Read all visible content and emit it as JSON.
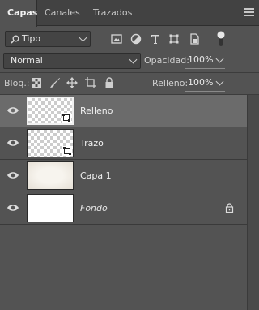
{
  "tabs": [
    {
      "label": "Capas",
      "active": true
    },
    {
      "label": "Canales",
      "active": false
    },
    {
      "label": "Trazados",
      "active": false
    }
  ],
  "filter": {
    "kind_label": "Tipo",
    "icons": [
      "image-filter-icon",
      "adjustment-filter-icon",
      "type-filter-icon",
      "shape-filter-icon",
      "smart-object-filter-icon",
      "filter-toggle-icon"
    ]
  },
  "blend": {
    "mode": "Normal",
    "opacity_label": "Opacidad:",
    "opacity_value": "100%"
  },
  "lock": {
    "label": "Bloq.:",
    "icons": [
      "lock-transparency-icon",
      "lock-pixels-icon",
      "lock-position-icon",
      "lock-artboard-icon",
      "lock-all-icon"
    ],
    "fill_label": "Relleno:",
    "fill_value": "100%"
  },
  "layers": [
    {
      "name": "Relleno",
      "thumb": "checker",
      "smart": true,
      "selected": true,
      "italic": false,
      "locked": false
    },
    {
      "name": "Trazo",
      "thumb": "checker",
      "smart": true,
      "selected": false,
      "italic": false,
      "locked": false
    },
    {
      "name": "Capa 1",
      "thumb": "paper",
      "smart": false,
      "selected": false,
      "italic": false,
      "locked": false
    },
    {
      "name": "Fondo",
      "thumb": "white",
      "smart": false,
      "selected": false,
      "italic": true,
      "locked": true
    }
  ]
}
